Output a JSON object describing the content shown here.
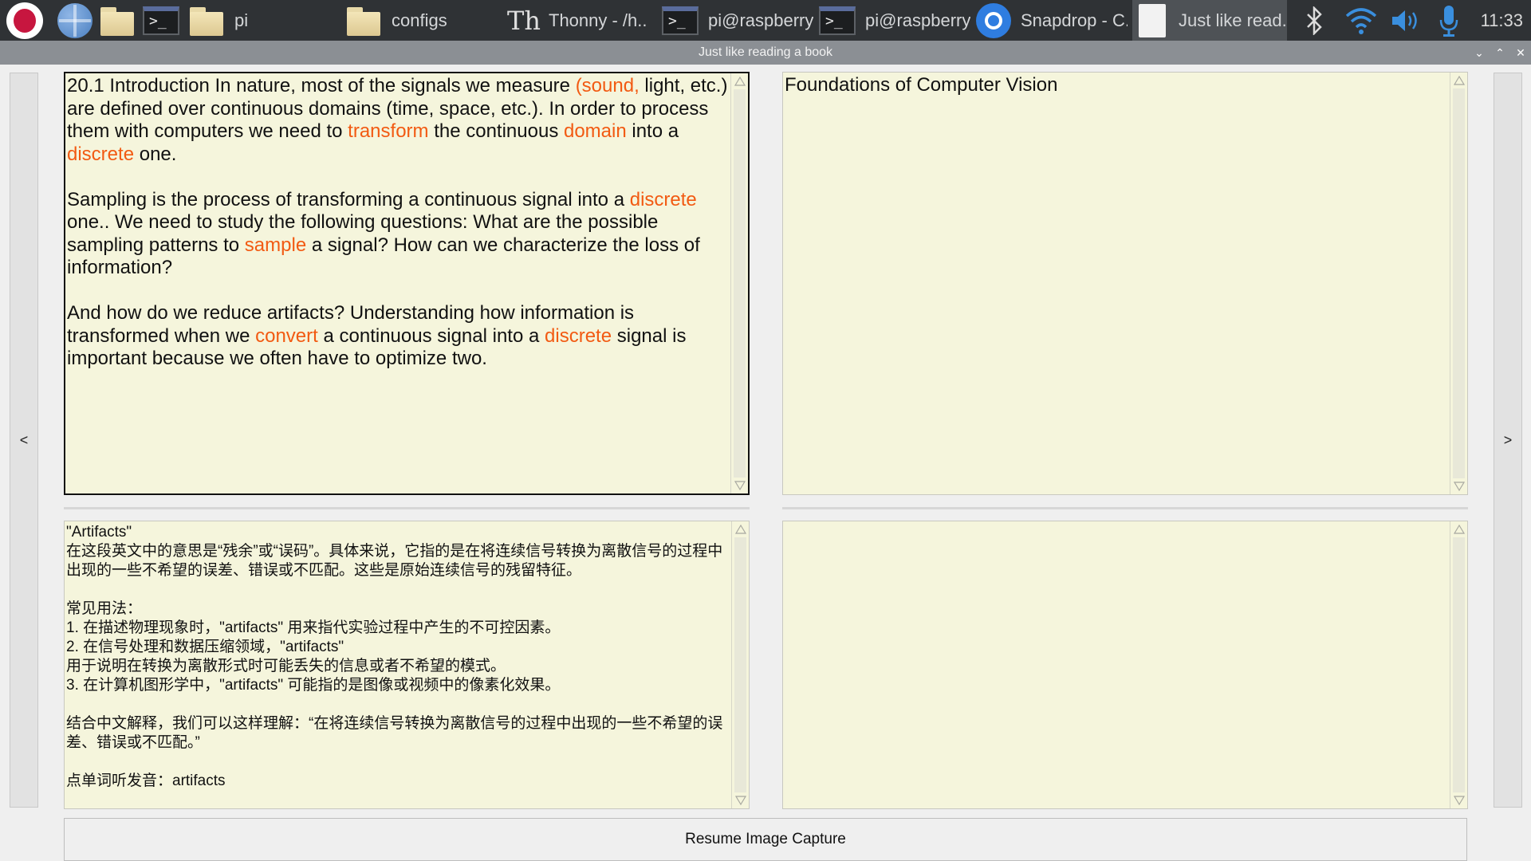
{
  "taskbar": {
    "launchers": [
      {
        "name": "raspberry-menu",
        "icon": "raspberry-pi-icon"
      },
      {
        "name": "web-browser",
        "icon": "globe-icon"
      },
      {
        "name": "file-manager",
        "icon": "folder-icon"
      },
      {
        "name": "terminal",
        "icon": "terminal-icon"
      }
    ],
    "windows": [
      {
        "label": "pi",
        "icon": "folder-icon"
      },
      {
        "label": "configs",
        "icon": "folder-icon"
      },
      {
        "label": "Thonny  -  /h..",
        "icon": "thonny-icon"
      },
      {
        "label": "pi@raspberry..",
        "icon": "terminal-icon"
      },
      {
        "label": "pi@raspberry..",
        "icon": "terminal-icon"
      },
      {
        "label": "Snapdrop - C..",
        "icon": "chromium-icon"
      },
      {
        "label": "Just like read..",
        "icon": "document-icon"
      }
    ],
    "tray": [
      "bluetooth-icon",
      "wifi-icon",
      "volume-icon",
      "microphone-icon"
    ],
    "clock": "11:33"
  },
  "window": {
    "title": "Just like reading a book",
    "controls": {
      "minimize": "⌄",
      "maximize": "⌃",
      "close": "✕"
    }
  },
  "nav": {
    "prev": "<",
    "next": ">"
  },
  "panes": {
    "source_text": {
      "segments_p1": [
        {
          "t": "20.1 Introduction In nature, most of the signals we measure ",
          "hl": false
        },
        {
          "t": "(sound,",
          "hl": true
        },
        {
          "t": " light, etc.) are defined over continuous domains (time, space, etc.). In order to process them with computers we need to ",
          "hl": false
        },
        {
          "t": "transform",
          "hl": true
        },
        {
          "t": " the continuous ",
          "hl": false
        },
        {
          "t": "domain",
          "hl": true
        },
        {
          "t": " into a ",
          "hl": false
        },
        {
          "t": "discrete",
          "hl": true
        },
        {
          "t": " one.",
          "hl": false
        }
      ],
      "segments_p2": [
        {
          "t": "Sampling is the process of transforming a continuous signal into a ",
          "hl": false
        },
        {
          "t": "discrete",
          "hl": true
        },
        {
          "t": " one.. We need to study the following questions: What are the possible sampling patterns to ",
          "hl": false
        },
        {
          "t": "sample",
          "hl": true
        },
        {
          "t": " a signal? How can we characterize the loss of information?",
          "hl": false
        }
      ],
      "segments_p3": [
        {
          "t": "And how do we reduce artifacts? Understanding how information is transformed when we ",
          "hl": false
        },
        {
          "t": "convert",
          "hl": true
        },
        {
          "t": " a continuous signal into a ",
          "hl": false
        },
        {
          "t": "discrete",
          "hl": true
        },
        {
          "t": " signal is important because we often have to optimize two.",
          "hl": false
        }
      ]
    },
    "book_title": "Foundations of Computer Vision",
    "definition": {
      "word": "\"Artifacts\"",
      "lines": [
        "在这段英文中的意思是“残余”或“误码”。具体来说，它指的是在将连续信号转换为离散信号的过程中出现的一些不希望的误差、错误或不匹配。这些是原始连续信号的残留特征。",
        "",
        "常见用法：",
        "1. 在描述物理现象时，\"artifacts\" 用来指代实验过程中产生的不可控因素。",
        "2. 在信号处理和数据压缩领域，\"artifacts\"",
        "用于说明在转换为离散形式时可能丢失的信息或者不希望的模式。",
        "3. 在计算机图形学中，\"artifacts\" 可能指的是图像或视频中的像素化效果。",
        "",
        "结合中文解释，我们可以这样理解：“在将连续信号转换为离散信号的过程中出现的一些不希望的误差、错误或不匹配。”",
        "",
        "点单词听发音：artifacts"
      ]
    },
    "notes": ""
  },
  "resume_button": "Resume Image Capture",
  "colors": {
    "pane_bg": "#f5f5dc",
    "highlight": "#f25a12",
    "taskbar_bg": "#2f3235",
    "titlebar_bg": "#8b8f94"
  }
}
